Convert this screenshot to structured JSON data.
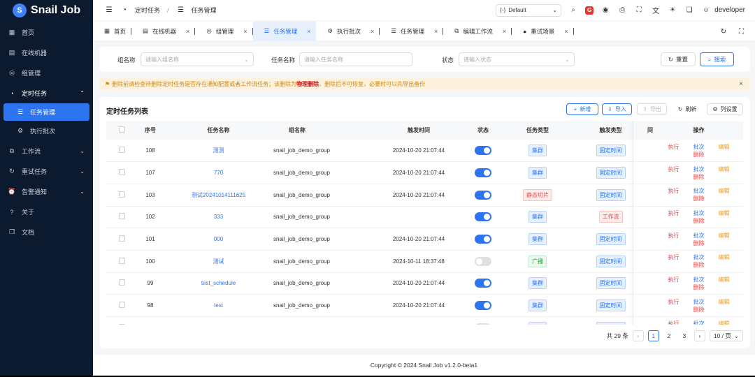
{
  "app": {
    "logo_text": "Snail Job",
    "logo_glyph": "S"
  },
  "sidebar": {
    "items": [
      {
        "label": "首页",
        "icon": "dashboard-icon",
        "glyph": "▦"
      },
      {
        "label": "在线机器",
        "icon": "server-icon",
        "glyph": "▤"
      },
      {
        "label": "组管理",
        "icon": "group-icon",
        "glyph": "◎"
      },
      {
        "label": "定时任务",
        "icon": "schedule-icon",
        "glyph": "◔",
        "arrow": "⌃"
      },
      {
        "label": "任务管理",
        "icon": "task-list-icon",
        "glyph": "☰"
      },
      {
        "label": "执行批次",
        "icon": "batch-icon",
        "glyph": "⚙"
      },
      {
        "label": "工作流",
        "icon": "workflow-icon",
        "glyph": "⧉",
        "arrow": "⌄"
      },
      {
        "label": "重试任务",
        "icon": "retry-icon",
        "glyph": "↻",
        "arrow": "⌄"
      },
      {
        "label": "告警通知",
        "icon": "alarm-icon",
        "glyph": "⏰",
        "arrow": "⌄"
      },
      {
        "label": "关于",
        "icon": "about-icon",
        "glyph": "?"
      },
      {
        "label": "文档",
        "icon": "doc-icon",
        "glyph": "❐"
      }
    ]
  },
  "topbar": {
    "crumb1": "定时任务",
    "crumb_sep": "/",
    "crumb2": "任务管理",
    "theme": "Default",
    "username": "developer",
    "icons": {
      "menu": "☰",
      "crumb1": "◔",
      "crumb2": "☰",
      "theme": "{◦}",
      "dropdown": "⌄",
      "search": "⌕",
      "github": "◉",
      "api": "⎙",
      "fullscreen": "⛶",
      "lang": "文",
      "theme_mode": "☀",
      "layout": "❏",
      "avatar": "☺"
    },
    "gitee_glyph": "G"
  },
  "tabs": {
    "items": [
      {
        "label": "首页",
        "glyph": "▦",
        "closable": false
      },
      {
        "label": "在线机器",
        "glyph": "▤",
        "closable": true
      },
      {
        "label": "组管理",
        "glyph": "◎",
        "closable": true
      },
      {
        "label": "任务管理",
        "glyph": "☰",
        "closable": true,
        "active": true
      },
      {
        "label": "执行批次",
        "glyph": "⚙",
        "closable": true
      },
      {
        "label": "任务管理",
        "glyph": "☰",
        "closable": true
      },
      {
        "label": "编辑工作流",
        "glyph": "⧉",
        "closable": true
      },
      {
        "label": "重试场景",
        "glyph": "●",
        "closable": true
      }
    ],
    "close_glyph": "×",
    "tools": {
      "refresh": "↻",
      "fullscreen": "⛶"
    }
  },
  "search": {
    "group_label": "组名称",
    "group_placeholder": "请输入组名称",
    "name_label": "任务名称",
    "name_placeholder": "请输入任务名称",
    "status_label": "状态",
    "status_placeholder": "请输入状态",
    "reset": "重置",
    "search": "搜索",
    "reset_glyph": "↻",
    "search_glyph": "⌕",
    "dropdown_glyph": "⌄"
  },
  "alert": {
    "icon": "⚑",
    "text_before": "删除前请检查待删除定时任务是否存在通知配置或者工作流任务；该删除为",
    "text_emph": "物理删除",
    "text_after": "，删除后不可恢复，必要时可以先导出备份",
    "close": "×"
  },
  "table": {
    "title": "定时任务列表",
    "toolbar": {
      "add": "新增",
      "import": "导入",
      "export": "导出",
      "refresh": "刷新",
      "columns": "列设置",
      "add_glyph": "+",
      "import_glyph": "⇩",
      "export_glyph": "⇧",
      "refresh_glyph": "↻",
      "columns_glyph": "⚙"
    },
    "headers": [
      "序号",
      "任务名称",
      "组名称",
      "触发时间",
      "状态",
      "任务类型",
      "触发类型",
      "间",
      "操作"
    ],
    "actions": {
      "run": "执行",
      "batch": "批次",
      "edit": "编辑",
      "delete": "删除"
    },
    "rows": [
      {
        "id": "108",
        "name": "测测",
        "group": "snail_job_demo_group",
        "time": "2024-10-20 21:07:44",
        "enabled": true,
        "type": "集群",
        "type_color": "blue",
        "trigger": "固定时间",
        "trigger_color": "blue"
      },
      {
        "id": "107",
        "name": "770",
        "group": "snail_job_demo_group",
        "time": "2024-10-20 21:07:44",
        "enabled": true,
        "type": "集群",
        "type_color": "blue",
        "trigger": "固定时间",
        "trigger_color": "blue"
      },
      {
        "id": "103",
        "name": "测试20241014111625",
        "group": "snail_job_demo_group",
        "time": "2024-10-20 21:07:44",
        "enabled": true,
        "type": "静态切片",
        "type_color": "red",
        "trigger": "固定时间",
        "trigger_color": "blue"
      },
      {
        "id": "102",
        "name": "333",
        "group": "snail_job_demo_group",
        "time": "",
        "enabled": true,
        "type": "集群",
        "type_color": "blue",
        "trigger": "工作流",
        "trigger_color": "red"
      },
      {
        "id": "101",
        "name": "000",
        "group": "snail_job_demo_group",
        "time": "2024-10-20 21:07:44",
        "enabled": true,
        "type": "集群",
        "type_color": "blue",
        "trigger": "固定时间",
        "trigger_color": "blue"
      },
      {
        "id": "100",
        "name": "测试",
        "group": "snail_job_demo_group",
        "time": "2024-10-11 18:37:48",
        "enabled": false,
        "type": "广播",
        "type_color": "green",
        "trigger": "固定时间",
        "trigger_color": "blue"
      },
      {
        "id": "99",
        "name": "test_schedule",
        "group": "snail_job_demo_group",
        "time": "2024-10-20 21:07:44",
        "enabled": true,
        "type": "集群",
        "type_color": "blue",
        "trigger": "固定时间",
        "trigger_color": "blue"
      },
      {
        "id": "98",
        "name": "test",
        "group": "snail_job_demo_group",
        "time": "2024-10-20 21:07:44",
        "enabled": true,
        "type": "集群",
        "type_color": "blue",
        "trigger": "固定时间",
        "trigger_color": "blue"
      },
      {
        "id": "",
        "name": "",
        "group": "",
        "time": "",
        "enabled": false,
        "type": "集群",
        "type_color": "blue",
        "trigger": "固定时间",
        "trigger_color": "blue"
      }
    ]
  },
  "pagination": {
    "total": "共 29 条",
    "pages": [
      "1",
      "2",
      "3"
    ],
    "current": "1",
    "page_size": "10 / 页",
    "prev": "‹",
    "next": "›"
  },
  "footer": {
    "copyright": "Copyright © 2024 Snail Job v1.2.0-beta1"
  },
  "colors": {
    "primary": "#2d74f0",
    "sidebar_bg": "#0c1a2f",
    "danger": "#e34848",
    "warning": "#f29c1b"
  }
}
